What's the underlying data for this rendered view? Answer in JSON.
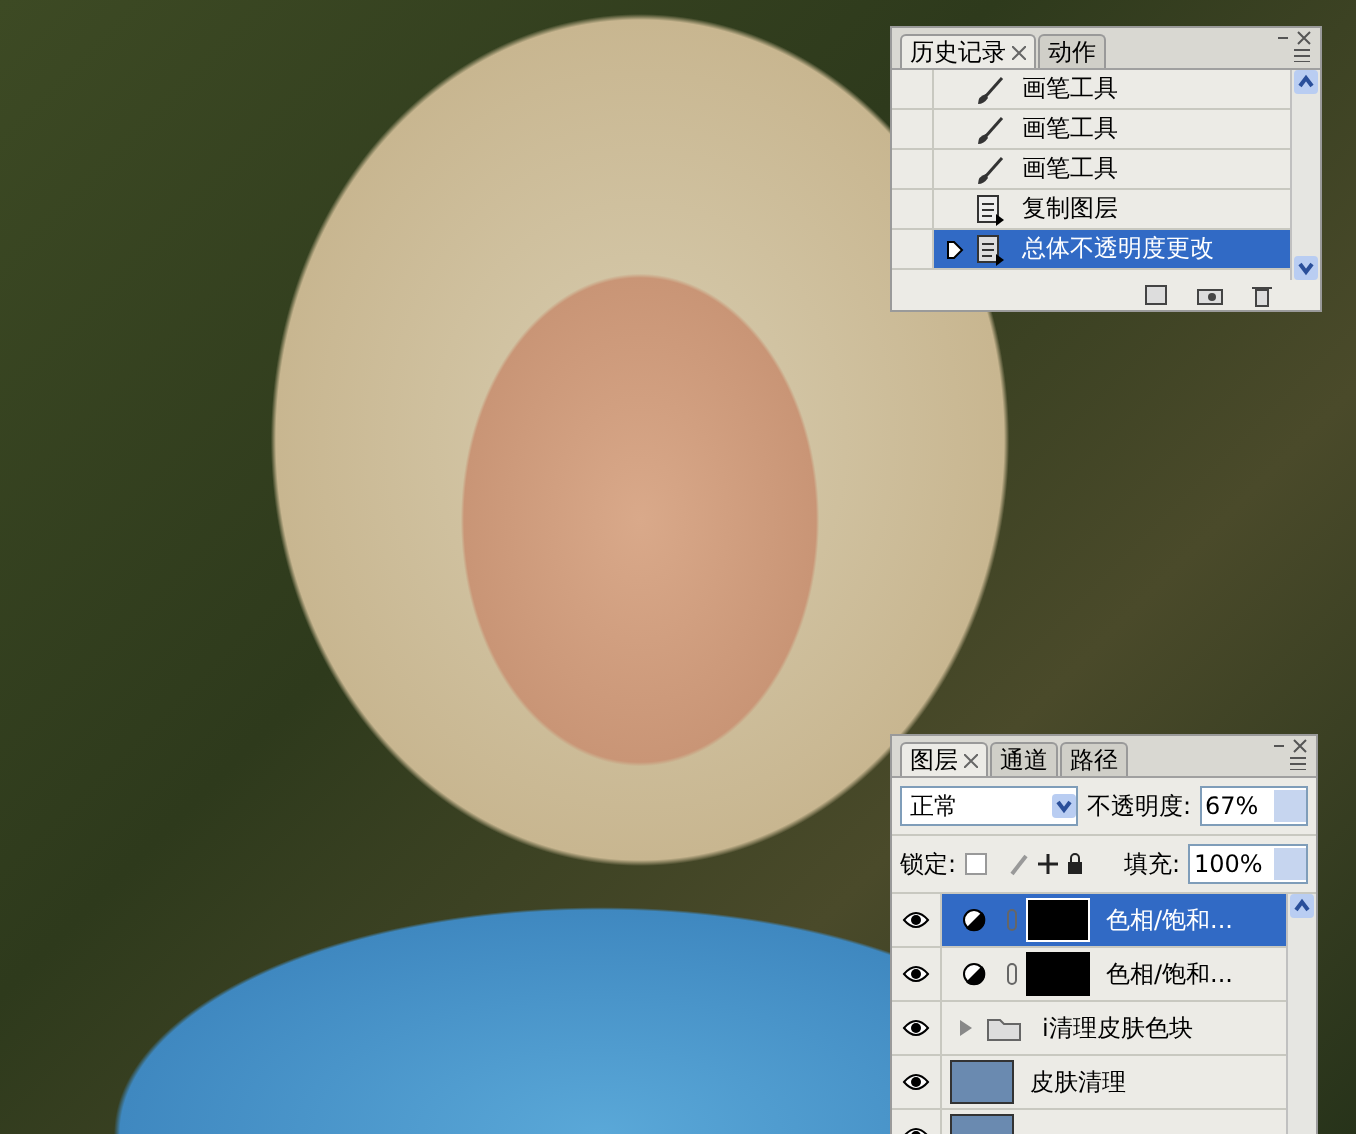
{
  "history_panel": {
    "tabs": [
      {
        "label": "历史记录",
        "selected": true
      },
      {
        "label": "动作",
        "selected": false
      }
    ],
    "items": [
      {
        "label": "画笔工具",
        "kind": "brush",
        "selected": false
      },
      {
        "label": "画笔工具",
        "kind": "brush",
        "selected": false
      },
      {
        "label": "画笔工具",
        "kind": "brush",
        "selected": false
      },
      {
        "label": "复制图层",
        "kind": "document",
        "selected": false
      },
      {
        "label": "总体不透明度更改",
        "kind": "document",
        "selected": true
      }
    ]
  },
  "layers_panel": {
    "tabs": [
      {
        "label": "图层",
        "selected": true
      },
      {
        "label": "通道",
        "selected": false
      },
      {
        "label": "路径",
        "selected": false
      }
    ],
    "blend_mode": "正常",
    "opacity_label": "不透明度:",
    "opacity": "67%",
    "lock_label": "锁定:",
    "fill_label": "填充:",
    "fill": "100%",
    "layers": [
      {
        "name": "色相/饱和...",
        "kind": "adjustment",
        "visible": true,
        "selected": true
      },
      {
        "name": "色相/饱和...",
        "kind": "adjustment",
        "visible": true,
        "selected": false
      },
      {
        "name": "i清理皮肤色块",
        "kind": "group",
        "visible": true,
        "selected": false
      },
      {
        "name": "皮肤清理",
        "kind": "pixel",
        "visible": true,
        "selected": false
      },
      {
        "kind": "pixel",
        "visible": true,
        "selected": false
      }
    ]
  }
}
